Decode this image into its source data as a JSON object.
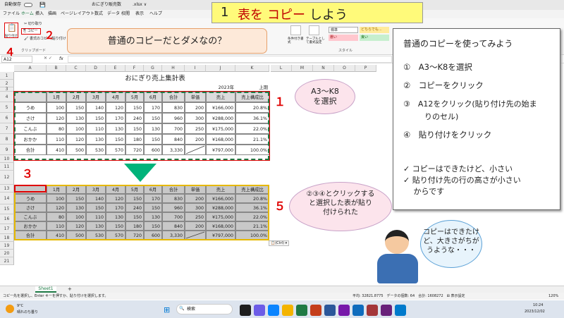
{
  "window": {
    "autosave": "自動保存",
    "filename": "おにぎり販売数",
    "ext": ".xlsx ∨"
  },
  "tabs": [
    "ファイル",
    "ホーム",
    "挿入",
    "描画",
    "ページレイアウト",
    "数式",
    "データ",
    "校閲",
    "表示",
    "ヘルプ"
  ],
  "ribbon": {
    "paste": "貼り付け",
    "cut": "切り取り",
    "copy": "コピー",
    "format_painter": "書式のコピー/貼り付け",
    "clipboard": "クリップボード",
    "conditional": "条件付き書式",
    "table": "テーブルとして書式設定",
    "styles": "スタイル",
    "style_standard": "標準",
    "style_neutral": "どちらでも...",
    "style_bad": "悪い",
    "style_good": "良い"
  },
  "namebox": "A12",
  "fx": "fx",
  "title_banner": {
    "num": "1",
    "text_a": "表を",
    "text_b": "コピー",
    "text_c": "しよう"
  },
  "question": "普通のコピーだとダメなの？",
  "sheet": {
    "title": "おにぎり売上集計表",
    "year": "2023年",
    "period": "上期",
    "headers": [
      "",
      "1月",
      "2月",
      "3月",
      "4月",
      "5月",
      "6月",
      "合計",
      "単価",
      "売上",
      "売上構成比"
    ],
    "rows": [
      [
        "うめ",
        "100",
        "150",
        "140",
        "120",
        "150",
        "170",
        "830",
        "200",
        "¥166,000",
        "20.8%"
      ],
      [
        "さけ",
        "120",
        "130",
        "150",
        "170",
        "240",
        "150",
        "960",
        "300",
        "¥288,000",
        "36.1%"
      ],
      [
        "こんぶ",
        "80",
        "100",
        "110",
        "130",
        "150",
        "130",
        "700",
        "250",
        "¥175,000",
        "22.0%"
      ],
      [
        "おかか",
        "110",
        "120",
        "130",
        "150",
        "180",
        "150",
        "840",
        "200",
        "¥168,000",
        "21.1%"
      ],
      [
        "合計",
        "410",
        "500",
        "530",
        "570",
        "720",
        "600",
        "3,330",
        "",
        "¥797,000",
        "100.0%"
      ]
    ]
  },
  "cols": [
    "A",
    "B",
    "C",
    "D",
    "E",
    "F",
    "G",
    "H",
    "I",
    "J",
    "K",
    "L",
    "M",
    "N",
    "O",
    "P"
  ],
  "rownums": [
    "1",
    "2",
    "3",
    "4",
    "5",
    "6",
    "7",
    "8",
    "9",
    "10",
    "11",
    "12",
    "13",
    "14",
    "15",
    "16",
    "17",
    "18",
    "19",
    "20",
    "21"
  ],
  "callouts": {
    "c1": "A3～K8\nを選択",
    "c5": "②③④とクリックする\nと選択した表が貼り\n付けられた",
    "c6": "コピーはできたけ\nど、大きさがちが\nうような・・・"
  },
  "markers": {
    "m1": "１",
    "m2": "２",
    "m3": "３",
    "m4": "４",
    "m5": "５"
  },
  "paste_tag": "(Ctrl) ▾",
  "panel": {
    "intro": "普通のコピーを使ってみよう",
    "steps": [
      "①　A3～K8を選択",
      "②　コピーをクリック",
      "③　A12をクリック(貼り付け先の始ま",
      "りのセル)",
      "④　貼り付けをクリック"
    ],
    "notes": [
      "✓ コピーはできたけど、小さい",
      "✓ 貼り付け先の行の高さが小さい",
      "　 からです"
    ]
  },
  "sheet_tab": "Sheet1",
  "add_sheet": "+",
  "status": {
    "left": "コピー先を選択し、Enter キーを押すか、貼り付けを選択します。",
    "sum": "平均: 32821.8775　データの個数: 64　合計: 1608272　⊞ 表示設定",
    "zoom": "120%"
  },
  "taskbar": {
    "weather_temp": "9°C",
    "weather_text": "晴れのち曇り",
    "search": "検索",
    "time": "10:24",
    "date": "2023/12/02"
  },
  "colors": {
    "accent": "#c00000",
    "green": "#1f7a45",
    "banner": "#fffa7a"
  }
}
